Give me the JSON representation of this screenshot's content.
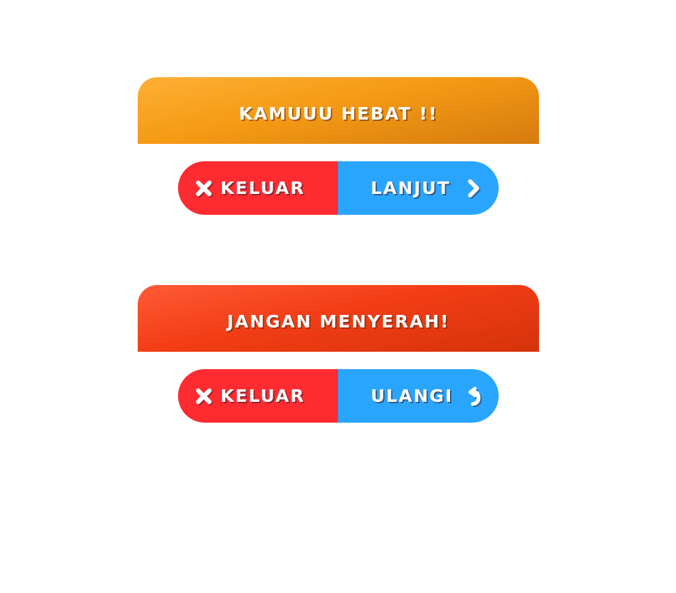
{
  "dialogs": [
    {
      "title": "KAMUUU HEBAT !!",
      "exit_label": "KELUAR",
      "exit_icon": "close-icon",
      "action_label": "LANJUT",
      "action_icon": "chevron-right-icon",
      "banner_color": "#f59a15"
    },
    {
      "title": "JANGAN MENYERAH!",
      "exit_label": "KELUAR",
      "exit_icon": "close-icon",
      "action_label": "ULANGI",
      "action_icon": "retry-arrow-icon",
      "banner_color": "#f23d16"
    }
  ],
  "colors": {
    "exit_button": "#fe2b30",
    "action_button": "#2aa5fd",
    "text": "#ffffff"
  }
}
